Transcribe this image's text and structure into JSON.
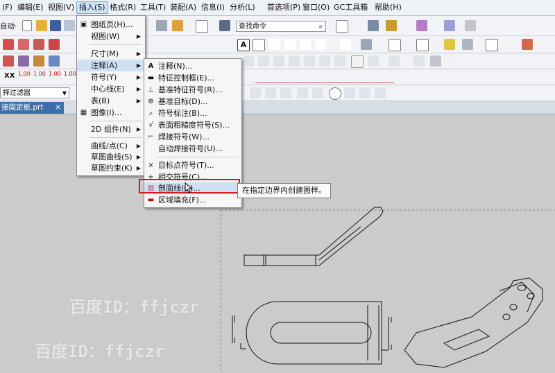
{
  "menubar": {
    "items": [
      "(F)",
      "编辑(E)",
      "视图(V)",
      "插入(S)",
      "格式(R)",
      "工具(T)",
      "装配(A)",
      "信息(I)",
      "分析(L)",
      "首选项(P)",
      "窗口(O)",
      "GC工具箱",
      "帮助(H)"
    ],
    "active_index": 3
  },
  "toolbar": {
    "auto_label": "自动·",
    "search_placeholder": "查找命令",
    "filter_label": "择过滤器",
    "number_labels": [
      "1.00",
      "1.00",
      "1.00",
      "1.00"
    ]
  },
  "tab": {
    "title": "接固定板.prt",
    "close_glyph": "×"
  },
  "insert_menu": {
    "items": [
      {
        "label": "图纸页(H)...",
        "icon": "▣"
      },
      {
        "label": "视图(W)",
        "sub": true
      },
      {
        "label": "尺寸(M)",
        "sub": true
      },
      {
        "label": "注释(A)",
        "sub": true,
        "highlighted": true
      },
      {
        "label": "符号(Y)",
        "sub": true
      },
      {
        "label": "中心线(E)",
        "sub": true
      },
      {
        "label": "表(B)",
        "sub": true
      },
      {
        "label": "图像(I)...",
        "icon": "▦"
      },
      {
        "label": "2D 组件(N)",
        "sub": true
      },
      {
        "label": "曲线/点(C)",
        "sub": true
      },
      {
        "label": "草图曲线(S)",
        "sub": true
      },
      {
        "label": "草图约束(K)",
        "sub": true
      }
    ]
  },
  "annotation_menu": {
    "items": [
      {
        "label": "注释(N)...",
        "icon": "A"
      },
      {
        "label": "特征控制框(E)...",
        "icon": "▬"
      },
      {
        "label": "基准特征符号(R)...",
        "icon": "⊥"
      },
      {
        "label": "基准目标(D)...",
        "icon": "⊕"
      },
      {
        "label": "符号标注(B)...",
        "icon": "⌕"
      },
      {
        "label": "表面粗糙度符号(S)...",
        "icon": "√"
      },
      {
        "label": "焊接符号(W)...",
        "icon": "⌐"
      },
      {
        "label": "自动焊接符号(U)...",
        "icon": ""
      },
      {
        "label": "目标点符号(T)...",
        "icon": "×"
      },
      {
        "label": "相交符号(C)...",
        "icon": "+"
      },
      {
        "label": "剖面线(O)...",
        "icon": "▨",
        "highlighted": true
      },
      {
        "label": "区域填充(F)...",
        "icon": "▬"
      }
    ]
  },
  "tooltip": "在指定边界内创建图样。",
  "watermarks": [
    "百度ID：ffjczr",
    "百度ID：ffjczr"
  ],
  "colors": {
    "accent": "#3f6fa9",
    "highlight_box": "#d9161c"
  }
}
